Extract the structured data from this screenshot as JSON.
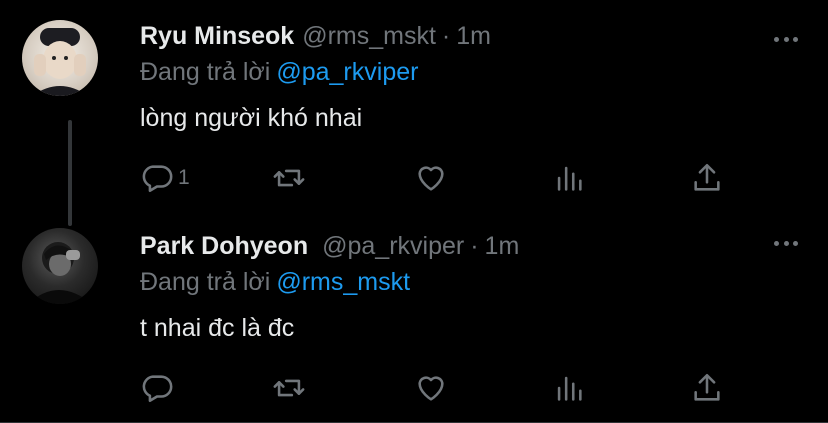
{
  "tweets": [
    {
      "name": "Ryu Minseok",
      "handle": "@rms_mskt",
      "separator": "·",
      "time": "1m",
      "reply_prefix": "Đang trả lời",
      "reply_to": "@pa_rkviper",
      "text": "lòng người khó nhai",
      "reply_count": "1"
    },
    {
      "name": "Park Dohyeon",
      "handle": "@pa_rkviper",
      "separator": "·",
      "time": "1m",
      "reply_prefix": "Đang trả lời",
      "reply_to": "@rms_mskt",
      "text": "t nhai đc là đc",
      "reply_count": ""
    }
  ],
  "colors": {
    "background": "#000000",
    "text": "#e7e9ea",
    "muted": "#71767b",
    "accent": "#1d9bf0"
  },
  "icons": [
    "reply-icon",
    "retweet-icon",
    "like-icon",
    "views-icon",
    "share-icon",
    "more-icon"
  ]
}
